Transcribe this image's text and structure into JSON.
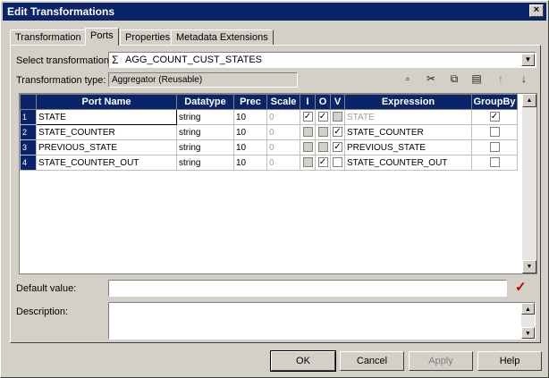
{
  "window": {
    "title": "Edit Transformations",
    "close_glyph": "×"
  },
  "tabs": [
    {
      "label": "Transformation"
    },
    {
      "label": "Ports"
    },
    {
      "label": "Properties"
    },
    {
      "label": "Metadata Extensions"
    }
  ],
  "form": {
    "select_label": "Select transformation:",
    "select_value": "AGG_COUNT_CUST_STATES",
    "type_label": "Transformation type:",
    "type_value": "Aggregator (Reusable)",
    "default_label": "Default value:",
    "default_value": "",
    "description_label": "Description:",
    "description_value": ""
  },
  "toolbar": {
    "icons": [
      "new-port-icon",
      "cut-icon",
      "copy-icon",
      "paste-icon",
      "move-up-icon",
      "move-down-icon"
    ]
  },
  "grid": {
    "columns": [
      "Port Name",
      "Datatype",
      "Prec",
      "Scale",
      "I",
      "O",
      "V",
      "Expression",
      "GroupBy"
    ],
    "rows": [
      {
        "num": "1",
        "name": "STATE",
        "datatype": "string",
        "prec": "10",
        "scale": "0",
        "i": true,
        "o": true,
        "v": false,
        "expression": "STATE",
        "groupby": true
      },
      {
        "num": "2",
        "name": "STATE_COUNTER",
        "datatype": "string",
        "prec": "10",
        "scale": "0",
        "i": false,
        "o": false,
        "v": true,
        "expression": "STATE_COUNTER",
        "groupby": false
      },
      {
        "num": "3",
        "name": "PREVIOUS_STATE",
        "datatype": "string",
        "prec": "10",
        "scale": "0",
        "i": false,
        "o": false,
        "v": true,
        "expression": "PREVIOUS_STATE",
        "groupby": false
      },
      {
        "num": "4",
        "name": "STATE_COUNTER_OUT",
        "datatype": "string",
        "prec": "10",
        "scale": "0",
        "i": false,
        "o": true,
        "v": false,
        "expression": "STATE_COUNTER_OUT",
        "groupby": false
      }
    ]
  },
  "buttons": {
    "ok": "OK",
    "cancel": "Cancel",
    "apply": "Apply",
    "help": "Help"
  },
  "colors": {
    "title_bar": "#0a246a",
    "header": "#0a246a",
    "check_red": "#c00000"
  }
}
